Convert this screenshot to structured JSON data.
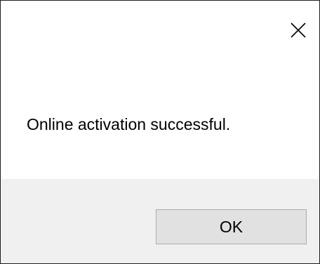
{
  "dialog": {
    "close_icon": "close-icon",
    "message": "Online activation successful.",
    "ok_label": "OK"
  },
  "colors": {
    "dialog_background": "#ffffff",
    "footer_background": "#f0f0f0",
    "button_background": "#e1e1e1",
    "button_border": "#adadad",
    "frame_border": "#1e1e1e"
  }
}
